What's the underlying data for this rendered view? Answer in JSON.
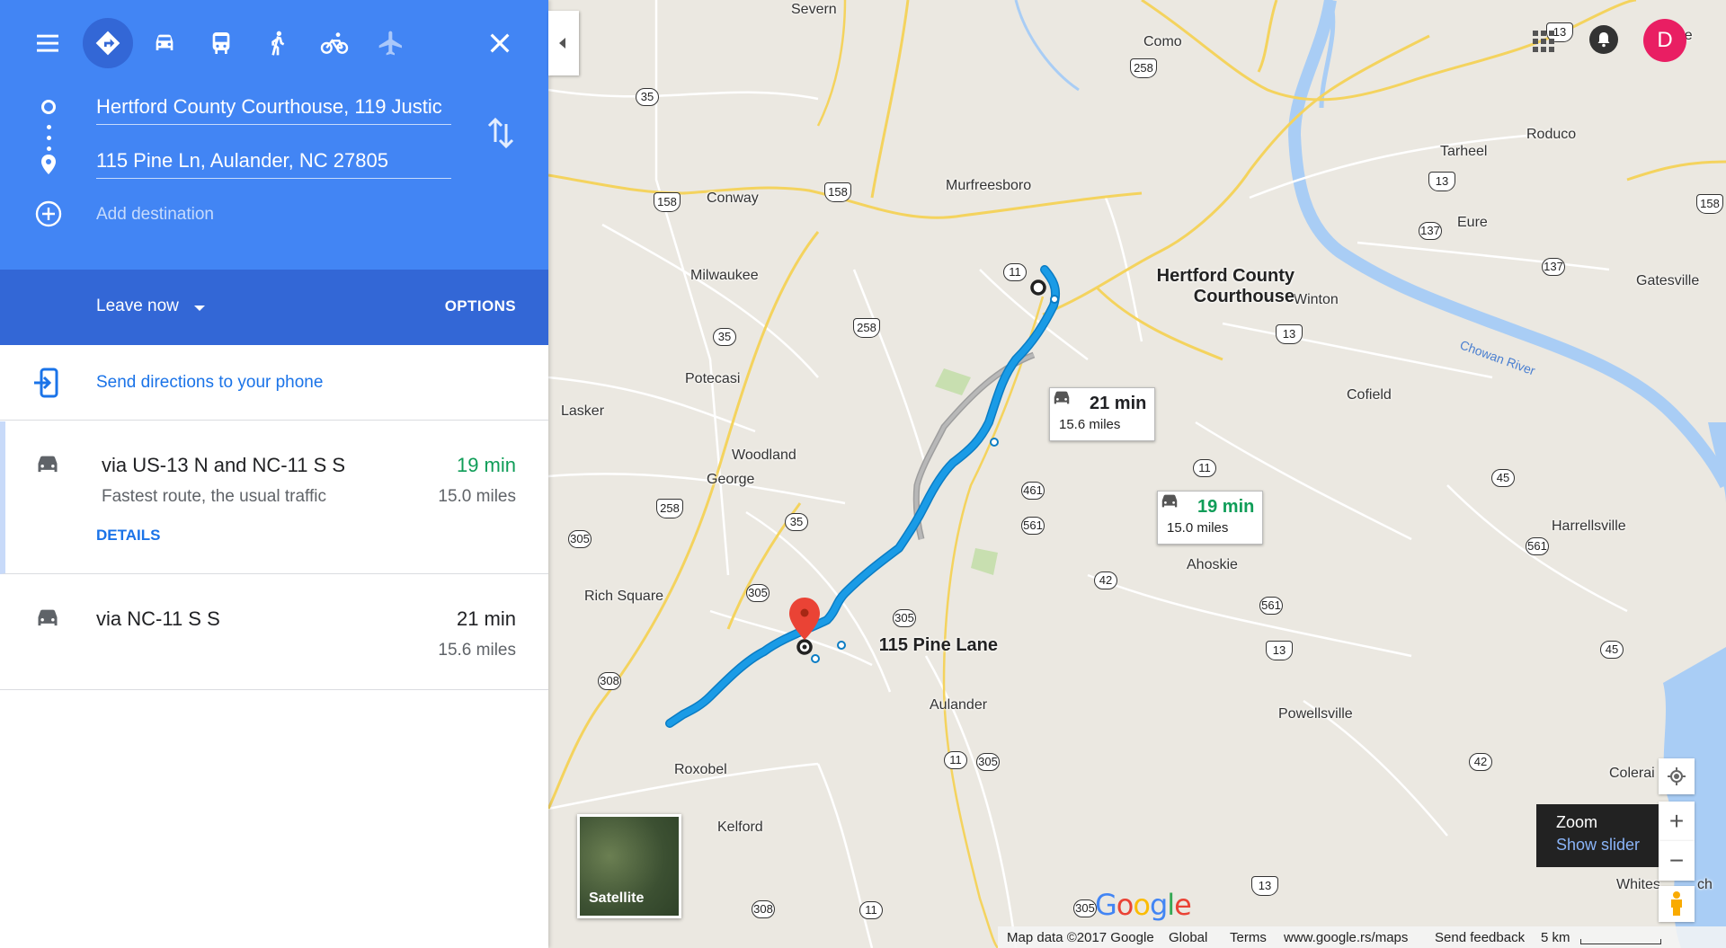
{
  "header": {
    "mode_names": [
      "menu-icon",
      "directions-icon",
      "car-icon",
      "transit-icon",
      "walk-icon",
      "bike-icon",
      "flight-icon",
      "close-icon"
    ],
    "origin": "Hertford County Courthouse, 119 Justic",
    "destination": "115 Pine Ln, Aulander, NC 27805",
    "add_destination": "Add destination",
    "leave_now": "Leave now",
    "options": "OPTIONS",
    "accent_color": "#4285f4",
    "accent_dark": "#3367d6"
  },
  "send": {
    "label": "Send directions to your phone"
  },
  "routes": [
    {
      "title": "via US-13 N and NC-11 S S",
      "time": "19 min",
      "time_color": "#0f9d58",
      "subtitle": "Fastest route, the usual traffic",
      "miles": "15.0 miles",
      "details": "DETAILS"
    },
    {
      "title": "via NC-11 S S",
      "time": "21 min",
      "time_color": "#202124",
      "miles": "15.6 miles"
    }
  ],
  "map": {
    "places": {
      "severn": "Severn",
      "como": "Como",
      "murfreesboro": "Murfreesboro",
      "conway": "Conway",
      "milwaukee": "Milwaukee",
      "tarheel": "Tarheel",
      "roduco": "Roduco",
      "eure": "Eure",
      "gatesville": "Gatesville",
      "gate": "Gate",
      "winton": "Winton",
      "cofield": "Cofield",
      "potecasi": "Potecasi",
      "lasker": "Lasker",
      "woodland": "Woodland",
      "george": "George",
      "rich_square": "Rich Square",
      "ahoskie": "Ahoskie",
      "harrellsville": "Harrellsville",
      "aulander": "Aulander",
      "powellsville": "Powellsville",
      "roxobel": "Roxobel",
      "kelford": "Kelford",
      "colerain": "Colerai",
      "whites": "Whites",
      "ch": "ch"
    },
    "river": "Chowan River",
    "origin_label_1": "Hertford County",
    "origin_label_2": "Courthouse",
    "dest_label": "115 Pine Lane",
    "shields": [
      "35",
      "258",
      "158",
      "158",
      "11",
      "35",
      "258",
      "13",
      "13",
      "137",
      "137",
      "158",
      "11",
      "461",
      "561",
      "35",
      "258",
      "305",
      "305",
      "42",
      "305",
      "561",
      "13",
      "45",
      "561",
      "45",
      "308",
      "11",
      "305",
      "42",
      "308",
      "11",
      "305",
      "13",
      "13"
    ],
    "bubble_alt": {
      "time": "21 min",
      "dist": "15.6 miles"
    },
    "bubble_best": {
      "time": "19 min",
      "dist": "15.0 miles"
    },
    "route_color": "#1a9be6",
    "alt_route_color": "#9e9e9e"
  },
  "controls": {
    "avatar": "D",
    "satellite": "Satellite",
    "zoom_in": "+",
    "zoom_out": "−",
    "zoom_tip_title": "Zoom",
    "zoom_tip_link": "Show slider"
  },
  "logo": {
    "g1": "G",
    "o1": "o",
    "o2": "o",
    "g2": "g",
    "l": "l",
    "e": "e"
  },
  "footer": {
    "mapdata": "Map data ©2017 Google",
    "global": "Global",
    "terms": "Terms",
    "site": "www.google.rs/maps",
    "feedback": "Send feedback",
    "scale": "5 km"
  }
}
